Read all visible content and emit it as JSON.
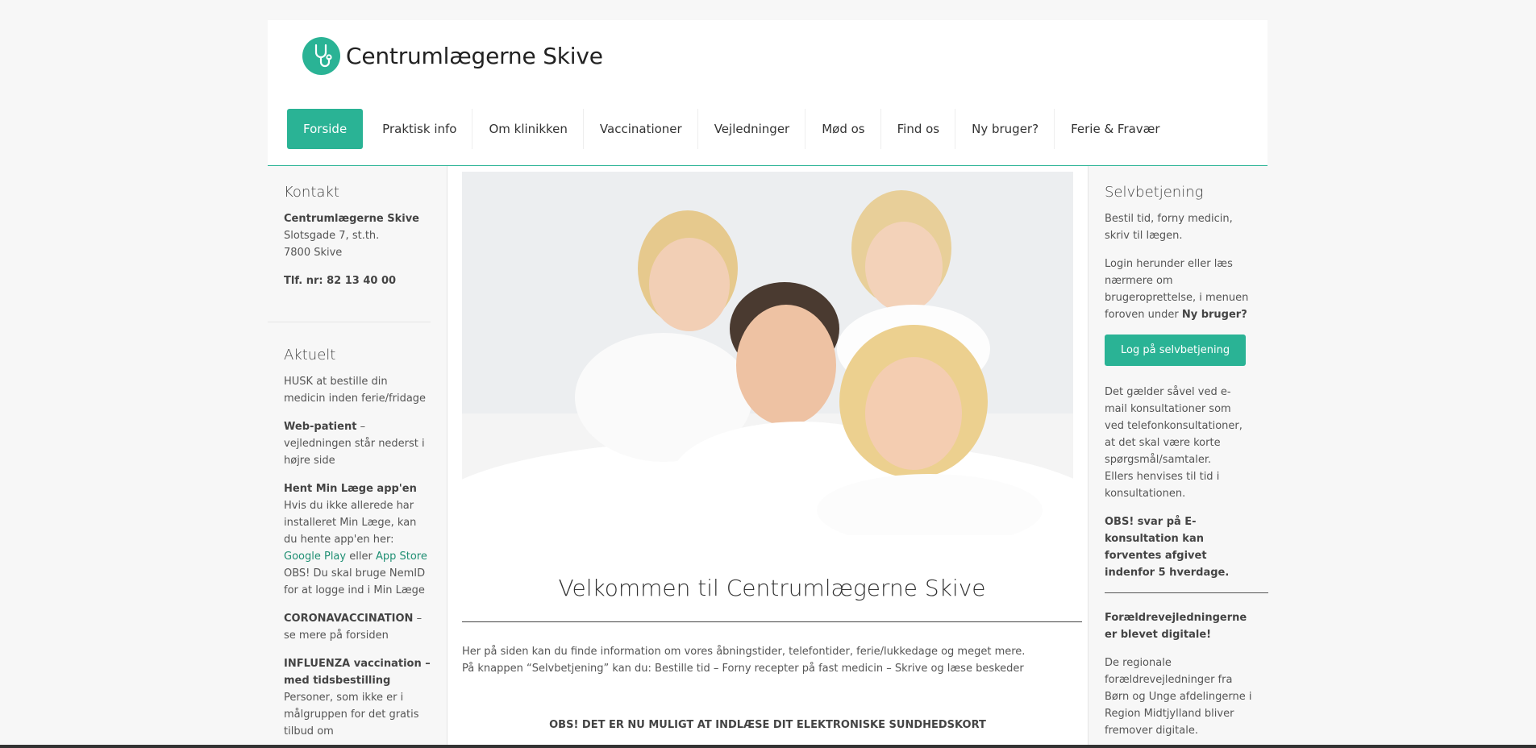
{
  "brand": {
    "name": "Centrumlægerne Skive",
    "accent": "#2ab395"
  },
  "nav": {
    "items": [
      {
        "label": "Forside",
        "active": true
      },
      {
        "label": "Praktisk info"
      },
      {
        "label": "Om klinikken"
      },
      {
        "label": "Vaccinationer"
      },
      {
        "label": "Vejledninger"
      },
      {
        "label": "Mød os"
      },
      {
        "label": "Find os"
      },
      {
        "label": "Ny bruger?"
      },
      {
        "label": "Ferie & Fravær"
      }
    ]
  },
  "left": {
    "kontakt": {
      "heading": "Kontakt",
      "name": "Centrumlægerne Skive",
      "address1": "Slotsgade 7, st.th.",
      "address2": "7800 Skive",
      "phone": "Tlf. nr: 82 13 40 00"
    },
    "aktuelt": {
      "heading": "Aktuelt",
      "item1": "HUSK at bestille din medicin inden ferie/fridage",
      "item2_bold": "Web-patient",
      "item2_rest": " – vejledningen står nederst i højre side",
      "item3_bold": "Hent Min Læge app'en",
      "item3_text": "Hvis du ikke allerede har installeret Min Læge, kan du hente app'en her: ",
      "item3_link1": "Google Play",
      "item3_mid": " eller ",
      "item3_link2": "App Store",
      "item3_obs": "OBS! Du skal bruge NemID for at logge ind i Min Læge",
      "item4_bold": "CORONAVACCINATION",
      "item4_rest": "  – se mere på forsiden",
      "item5_bold": "INFLUENZA vaccination – med tidsbestilling",
      "item5_text": "Personer, som ikke er i målgruppen for det gratis tilbud om"
    }
  },
  "right": {
    "heading": "Selvbetjening",
    "p1": "Bestil tid, forny medicin, skriv til lægen.",
    "p2_text": "Login herunder eller læs nærmere om brugeroprettelse, i menuen foroven under ",
    "p2_bold": "Ny bruger?",
    "button": "Log på selvbetjening",
    "p3": "Det gælder såvel ved e-mail konsultationer som ved telefonkonsultationer, at det skal være korte spørgsmål/samtaler.",
    "p3b": "Ellers henvises til tid i konsultationen.",
    "p4_bold": "OBS! svar på E-konsultation kan forventes afgivet indenfor 5 hverdage.",
    "p5_bold": "Forældrevejledningerne er blevet digitale!",
    "p6": "De regionale forældrevejledninger fra Børn og Unge afdelingerne i Region Midtjylland bliver fremover digitale."
  },
  "main": {
    "title": "Velkommen til Centrumlægerne Skive",
    "line1": "Her på siden kan du finde information om vores åbningstider, telefontider, ferie/lukkedage og meget mere.",
    "line2": "På knappen “Selvbetjening” kan du: Bestille tid – Forny recepter på fast medicin – Skrive og læse beskeder",
    "notice": "OBS! DET ER NU MULIGT AT INDLÆSE DIT ELEKTRONISKE SUNDHEDSKORT"
  }
}
